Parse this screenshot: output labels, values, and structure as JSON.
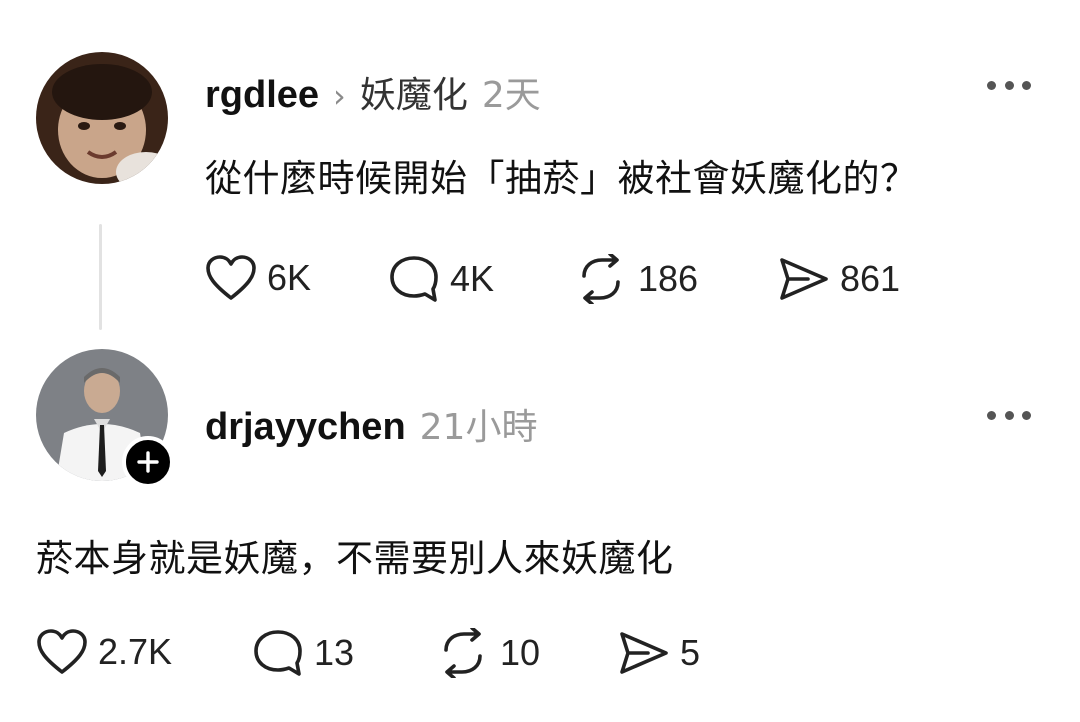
{
  "posts": [
    {
      "username": "rgdlee",
      "community": "妖魔化",
      "time": "2天",
      "text": "從什麼時候開始「抽菸」被社會妖魔化的？",
      "likes": "6K",
      "replies": "4K",
      "reposts": "186",
      "shares": "861"
    },
    {
      "username": "drjayychen",
      "time": "21小時",
      "text": "菸本身就是妖魔，不需要別人來妖魔化",
      "likes": "2.7K",
      "replies": "13",
      "reposts": "10",
      "shares": "5"
    }
  ],
  "icons": {
    "like": "heart-icon",
    "reply": "comment-bubble-icon",
    "repost": "repost-arrows-icon",
    "share": "send-icon",
    "more": "more-dots-icon",
    "follow": "plus-icon",
    "community_sep": "chevron-right-icon"
  }
}
